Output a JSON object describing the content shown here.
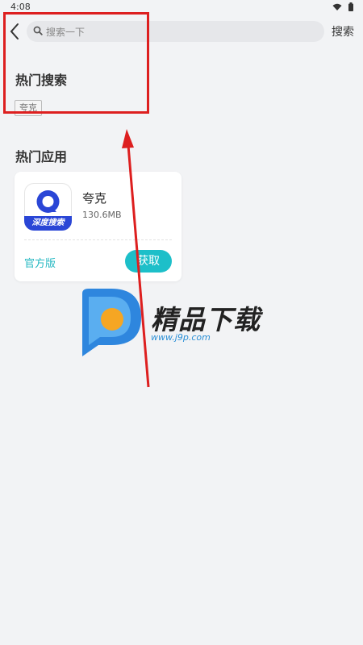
{
  "status_bar": {
    "time": "4:08"
  },
  "search": {
    "placeholder": "搜索一下",
    "button_label": "搜索"
  },
  "hot_search": {
    "title": "热门搜索",
    "tags": [
      "夸克"
    ]
  },
  "hot_apps": {
    "title": "热门应用",
    "items": [
      {
        "name": "夸克",
        "size": "130.6MB",
        "icon_band_text": "深度搜索",
        "badge": "官方版",
        "action_label": "获取"
      }
    ]
  },
  "watermark": {
    "title": "精品下载",
    "url": "www.j9p.com"
  },
  "colors": {
    "accent": "#1dbfc9",
    "highlight": "#dd1f1f",
    "arrow": "#dd1f1f"
  }
}
